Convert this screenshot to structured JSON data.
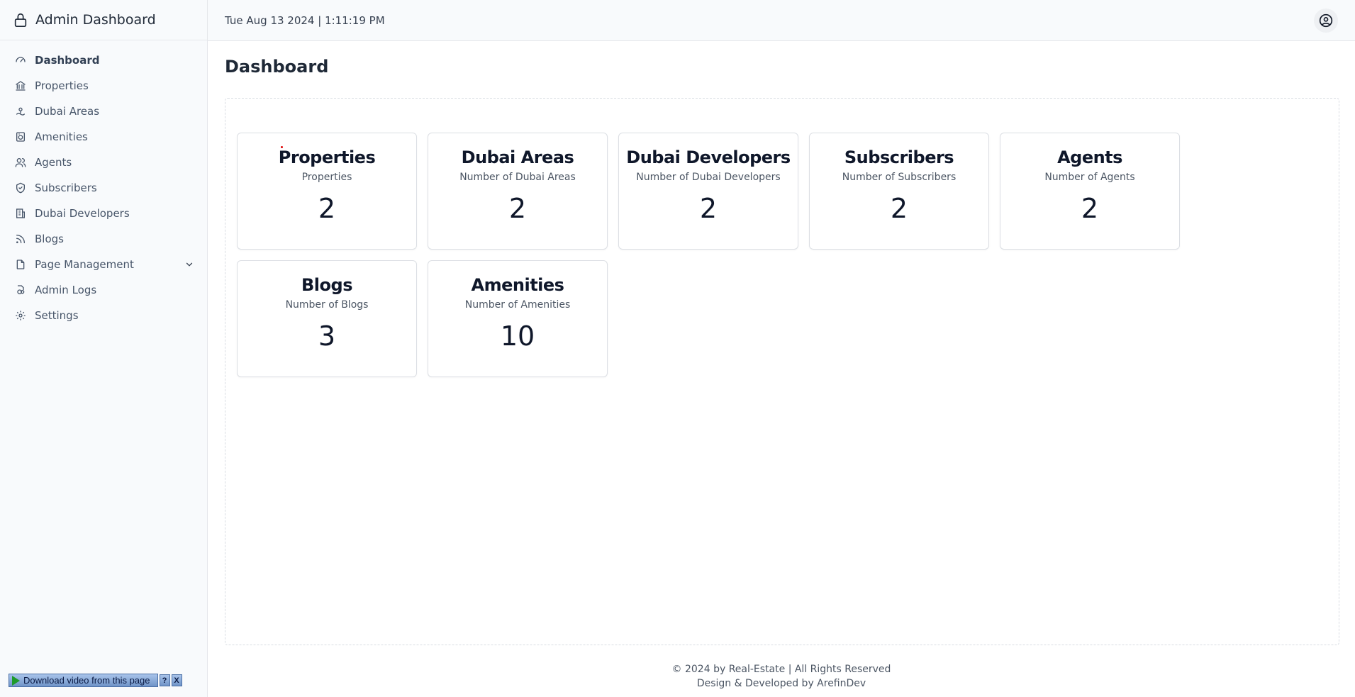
{
  "brand": {
    "title": "Admin Dashboard",
    "icon": "lock-icon"
  },
  "sidebar": {
    "items": [
      {
        "label": "Dashboard",
        "icon": "gauge-icon",
        "active": true
      },
      {
        "label": "Properties",
        "icon": "bank-icon"
      },
      {
        "label": "Dubai Areas",
        "icon": "map-pin-icon"
      },
      {
        "label": "Amenities",
        "icon": "amenities-icon"
      },
      {
        "label": "Agents",
        "icon": "users-icon"
      },
      {
        "label": "Subscribers",
        "icon": "shield-check-icon"
      },
      {
        "label": "Dubai Developers",
        "icon": "building-icon"
      },
      {
        "label": "Blogs",
        "icon": "rss-icon"
      },
      {
        "label": "Page Management",
        "icon": "file-icon",
        "has_submenu": true
      },
      {
        "label": "Admin Logs",
        "icon": "logs-icon"
      },
      {
        "label": "Settings",
        "icon": "gear-icon"
      }
    ]
  },
  "header": {
    "datetime": "Tue Aug 13 2024 | 1:11:19 PM",
    "user_icon": "user-circle-icon"
  },
  "main": {
    "title": "Dashboard",
    "cards": [
      {
        "title": "Properties",
        "subtitle": "Properties",
        "value": "2"
      },
      {
        "title": "Dubai Areas",
        "subtitle": "Number of Dubai Areas",
        "value": "2"
      },
      {
        "title": "Dubai Developers",
        "subtitle": "Number of Dubai Developers",
        "value": "2"
      },
      {
        "title": "Subscribers",
        "subtitle": "Number of Subscribers",
        "value": "2"
      },
      {
        "title": "Agents",
        "subtitle": "Number of Agents",
        "value": "2"
      },
      {
        "title": "Blogs",
        "subtitle": "Number of Blogs",
        "value": "3"
      },
      {
        "title": "Amenities",
        "subtitle": "Number of Amenities",
        "value": "10"
      }
    ]
  },
  "footer": {
    "line1": "© 2024 by Real-Estate | All Rights Reserved",
    "line2": "Design & Developed by ArefinDev"
  },
  "download_bar": {
    "label": "Download video from this page",
    "help": "?",
    "close": "X"
  },
  "colors": {
    "sidebar_bg": "#f8fafc",
    "text_dark": "#0f172a",
    "muted": "#4b5563",
    "border": "#dcdfe4"
  }
}
